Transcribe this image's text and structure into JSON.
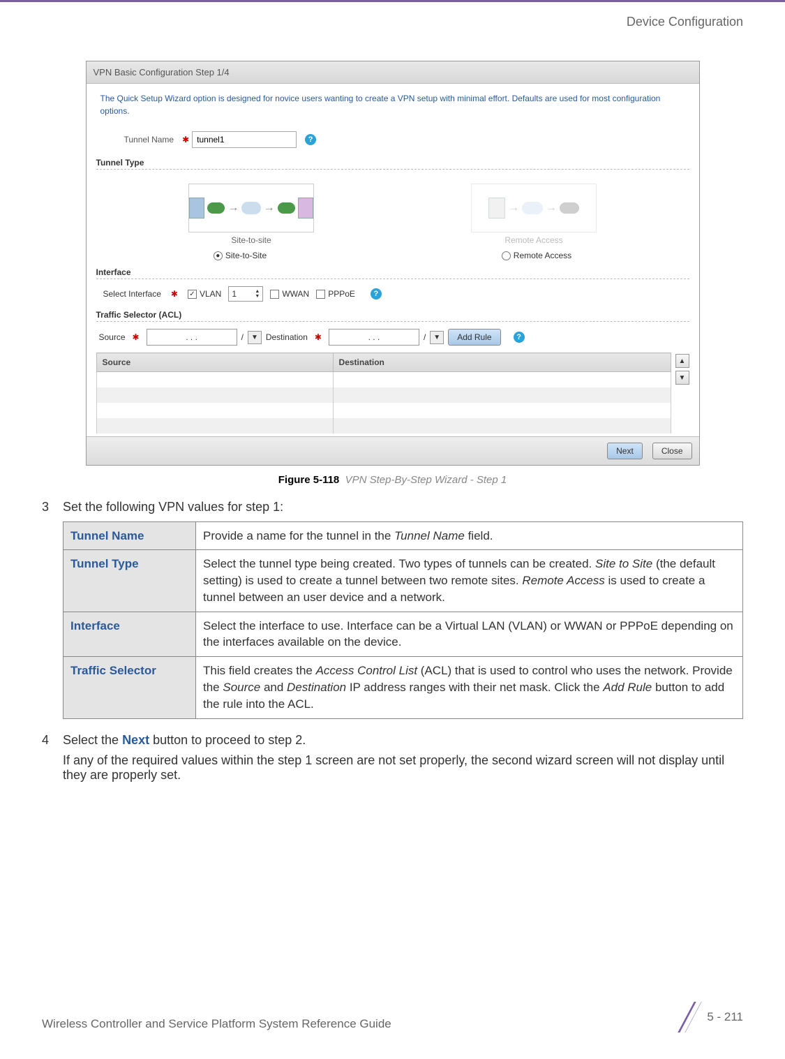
{
  "header": {
    "section_title": "Device Configuration"
  },
  "screenshot": {
    "wizard_title": "VPN Basic Configuration  Step 1/4",
    "description": "The Quick Setup Wizard option is designed for novice users wanting to create a VPN setup with minimal effort. Defaults are used for most configuration options.",
    "tunnel_name": {
      "label": "Tunnel Name",
      "value": "tunnel1"
    },
    "tunnel_type": {
      "heading": "Tunnel Type",
      "opt1_caption": "Site-to-site",
      "opt2_caption": "Remote Access",
      "radio1": "Site-to-Site",
      "radio2": "Remote Access"
    },
    "interface": {
      "heading": "Interface",
      "label": "Select Interface",
      "vlan": "VLAN",
      "vlan_value": "1",
      "wwan": "WWAN",
      "pppoe": "PPPoE"
    },
    "traffic": {
      "heading": "Traffic Selector (ACL)",
      "source": "Source",
      "destination": "Destination",
      "ip_placeholder": ".       .       .",
      "slash": "/",
      "add_rule": "Add Rule"
    },
    "table": {
      "col1": "Source",
      "col2": "Destination"
    },
    "buttons": {
      "next": "Next",
      "close": "Close"
    }
  },
  "figure": {
    "number": "Figure 5-118",
    "caption": "VPN Step-By-Step Wizard - Step 1"
  },
  "step3": {
    "num": "3",
    "text": "Set the following VPN values for step 1:",
    "rows": [
      {
        "label": "Tunnel Name",
        "desc_pre": "Provide a name for the tunnel in the ",
        "desc_em": "Tunnel Name",
        "desc_post": " field."
      },
      {
        "label": "Tunnel Type",
        "desc_pre": "Select the tunnel type being created. Two types of tunnels can be created. ",
        "desc_em": "Site to Site",
        "desc_mid": " (the default setting) is used to create a tunnel between two remote sites. ",
        "desc_em2": "Remote Access",
        "desc_post": " is used to create a tunnel between an user device and a network."
      },
      {
        "label": "Interface",
        "desc": "Select the interface to use. Interface can be a Virtual LAN (VLAN) or WWAN or PPPoE depending on the interfaces available on the device."
      },
      {
        "label": "Traffic Selector",
        "desc_pre": "This field creates the ",
        "desc_em": "Access Control List",
        "desc_mid": " (ACL) that is used to control who uses the network. Provide the ",
        "desc_em2": "Source",
        "desc_mid2": " and ",
        "desc_em3": "Destination",
        "desc_mid3": " IP address ranges with their net mask. Click the ",
        "desc_em4": "Add Rule",
        "desc_post": " button to add the rule into the ACL."
      }
    ]
  },
  "step4": {
    "num": "4",
    "text_pre": "Select the ",
    "text_btn": "Next",
    "text_post": " button to proceed to step 2.",
    "para2": "If any of the required values within the step 1 screen are not set properly, the second wizard screen will not display until they are properly set."
  },
  "footer": {
    "guide": "Wireless Controller and Service Platform System Reference Guide",
    "page": "5 - 211"
  }
}
